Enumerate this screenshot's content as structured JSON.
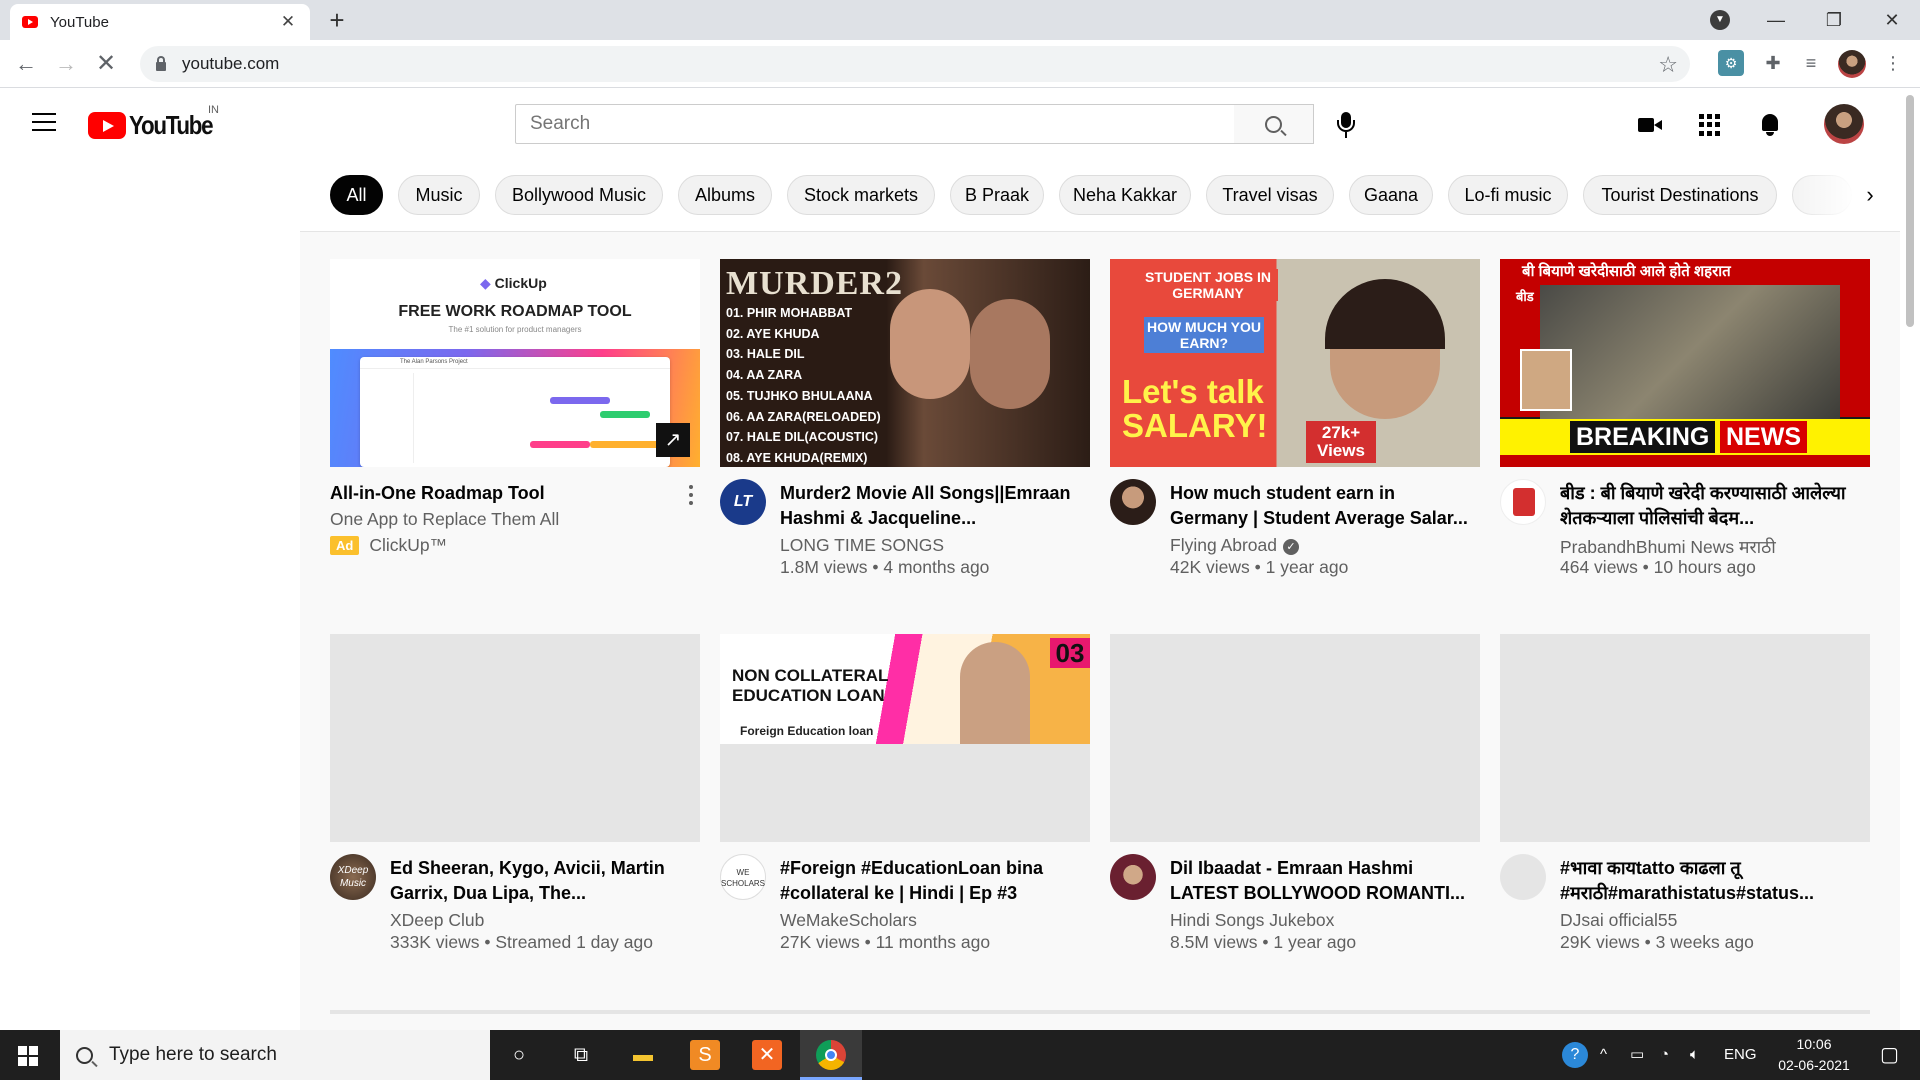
{
  "browser": {
    "tab_title": "YouTube",
    "url": "youtube.com"
  },
  "header": {
    "logo_text": "YouTube",
    "country_code": "IN",
    "search_placeholder": "Search"
  },
  "chips": [
    "All",
    "Music",
    "Bollywood Music",
    "Albums",
    "Stock markets",
    "B Praak",
    "Neha Kakkar",
    "Travel visas",
    "Gaana",
    "Lo-fi music",
    "Tourist Destinations"
  ],
  "ad": {
    "title": "All-in-One Roadmap Tool",
    "subtitle": "One App to Replace Them All",
    "badge": "Ad",
    "advertiser": "ClickUp™",
    "thumb_brand": "ClickUp",
    "thumb_headline": "FREE WORK ROADMAP TOOL",
    "thumb_sub": "The #1 solution for product managers",
    "thumb_window_title": "The Alan Parsons Project"
  },
  "videos": [
    {
      "title": "Murder2 Movie All Songs||Emraan Hashmi & Jacqueline...",
      "channel": "LONG TIME SONGS",
      "stats": "1.8M views • 4 months ago",
      "avatar_text": "LT",
      "thumb_title": "MURDER2",
      "thumb_tracks": [
        "01. PHIR MOHABBAT",
        "02. AYE KHUDA",
        "03. HALE DIL",
        "04. AA ZARA",
        "05. TUJHKO BHULAANA",
        "06. AA ZARA(RELOADED)",
        "07. HALE DIL(ACOUSTIC)",
        "08. AYE KHUDA(REMIX)"
      ]
    },
    {
      "title": "How much student earn in Germany | Student Average Salar...",
      "channel": "Flying Abroad",
      "verified": true,
      "stats": "42K views • 1 year ago",
      "thumb_lines": [
        "STUDENT JOBS IN GERMANY",
        "HOW MUCH YOU EARN?",
        "Let's talk",
        "SALARY!",
        "27k+",
        "Views"
      ]
    },
    {
      "title": "बीड : बी बियाणे खरेदी करण्यासाठी आलेल्या शेतकऱ्याला पोलिसांची बेदम...",
      "channel": "PrabandhBhumi News मराठी",
      "stats": "464 views • 10 hours ago",
      "thumb_top": "बी बियाणे खरेदीसाठी आले होते शहरात",
      "thumb_place": "बीड",
      "thumb_breaking": "BREAKING",
      "thumb_news": "NEWS"
    },
    {
      "title": "Ed Sheeran, Kygo, Avicii, Martin Garrix, Dua Lipa, The...",
      "channel": "XDeep Club",
      "stats": "333K views • Streamed 1 day ago",
      "avatar_text": "XDeep Music"
    },
    {
      "title": "#Foreign #EducationLoan bina #collateral ke | Hindi | Ep #3",
      "channel": "WeMakeScholars",
      "stats": "27K views • 11 months ago",
      "avatar_text": "WE SCHOLARS",
      "thumb_headline": "NON COLLATERAL EDUCATION LOAN",
      "thumb_sub": "Foreign Education loan",
      "thumb_ep": "03"
    },
    {
      "title": "Dil Ibaadat - Emraan Hashmi LATEST BOLLYWOOD ROMANTI...",
      "channel": "Hindi Songs Jukebox",
      "stats": "8.5M views • 1 year ago"
    },
    {
      "title": "#भावा कायtatto काढला तू #मराठी#marathistatus#status...",
      "channel": "DJsai official55",
      "stats": "29K views • 3 weeks ago"
    }
  ],
  "taskbar": {
    "search_placeholder": "Type here to search",
    "lang": "ENG",
    "time": "10:06",
    "date": "02-06-2021"
  }
}
